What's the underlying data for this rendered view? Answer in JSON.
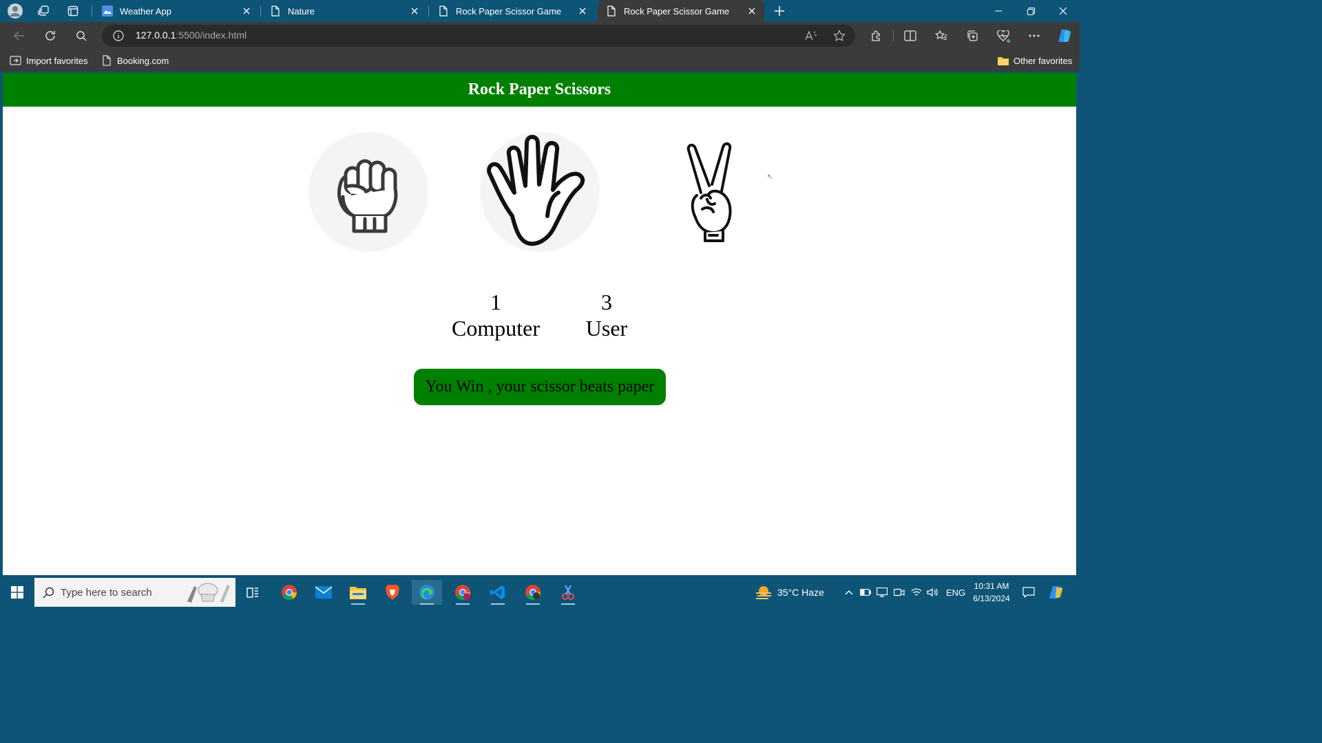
{
  "browser": {
    "tabs": [
      {
        "title": "Weather App",
        "icon": "weather-favicon",
        "active": false
      },
      {
        "title": "Nature",
        "icon": "page-icon",
        "active": false
      },
      {
        "title": "Rock Paper Scissor Game",
        "icon": "page-icon",
        "active": false
      },
      {
        "title": "Rock Paper Scissor Game",
        "icon": "page-icon",
        "active": true
      }
    ],
    "address": {
      "host": "127.0.0.1",
      "path": ":5500/index.html"
    },
    "favorites": {
      "import_label": "Import favorites",
      "booking_label": "Booking.com",
      "other_label": "Other favorites"
    }
  },
  "game": {
    "title": "Rock Paper Scissors",
    "choices": [
      "rock",
      "paper",
      "scissor"
    ],
    "computer_score": "1",
    "computer_label": "Computer",
    "user_score": "3",
    "user_label": "User",
    "message": "You Win , your scissor beats paper",
    "accent_color": "#008000"
  },
  "taskbar": {
    "search_placeholder": "Type here to search",
    "weather": "35°C  Haze",
    "language": "ENG",
    "time": "10:31 AM",
    "date": "6/13/2024"
  }
}
